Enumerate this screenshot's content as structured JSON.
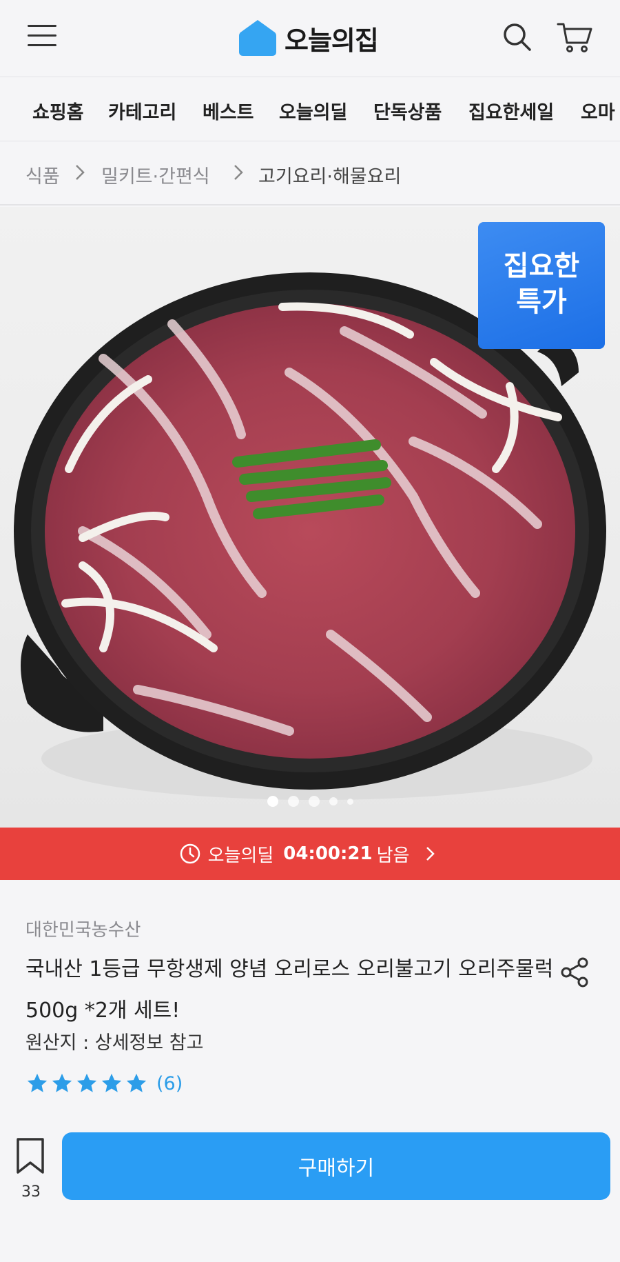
{
  "header": {
    "logo_text": "오늘의집",
    "menu_icon": "hamburger-icon",
    "search_icon": "search-icon",
    "cart_icon": "cart-icon",
    "brand_color": "#35a5f2"
  },
  "nav": {
    "items": [
      "쇼핑홈",
      "카테고리",
      "베스트",
      "오늘의딜",
      "단독상품",
      "집요한세일",
      "오마"
    ]
  },
  "breadcrumb": [
    "식품",
    "밀키트·간편식",
    "고기요리·해물요리"
  ],
  "hero": {
    "badge_line1": "집요한",
    "badge_line2": "특가",
    "dots_total": 5,
    "dots_active": 1
  },
  "deal": {
    "label": "오늘의딜",
    "time": "04:00:21",
    "suffix": "남음",
    "color": "#e8413d"
  },
  "product": {
    "brand": "대한민국농수산",
    "title": "국내산 1등급 무항생제 양념 오리로스 오리불고기 오리주물럭 500g *2개 세트!",
    "origin": "원산지 : 상세정보 참고",
    "rating_stars": 5,
    "review_count": "(6)"
  },
  "bottom_bar": {
    "bookmark_count": "33",
    "buy_label": "구매하기",
    "buy_color": "#2a9df4"
  }
}
